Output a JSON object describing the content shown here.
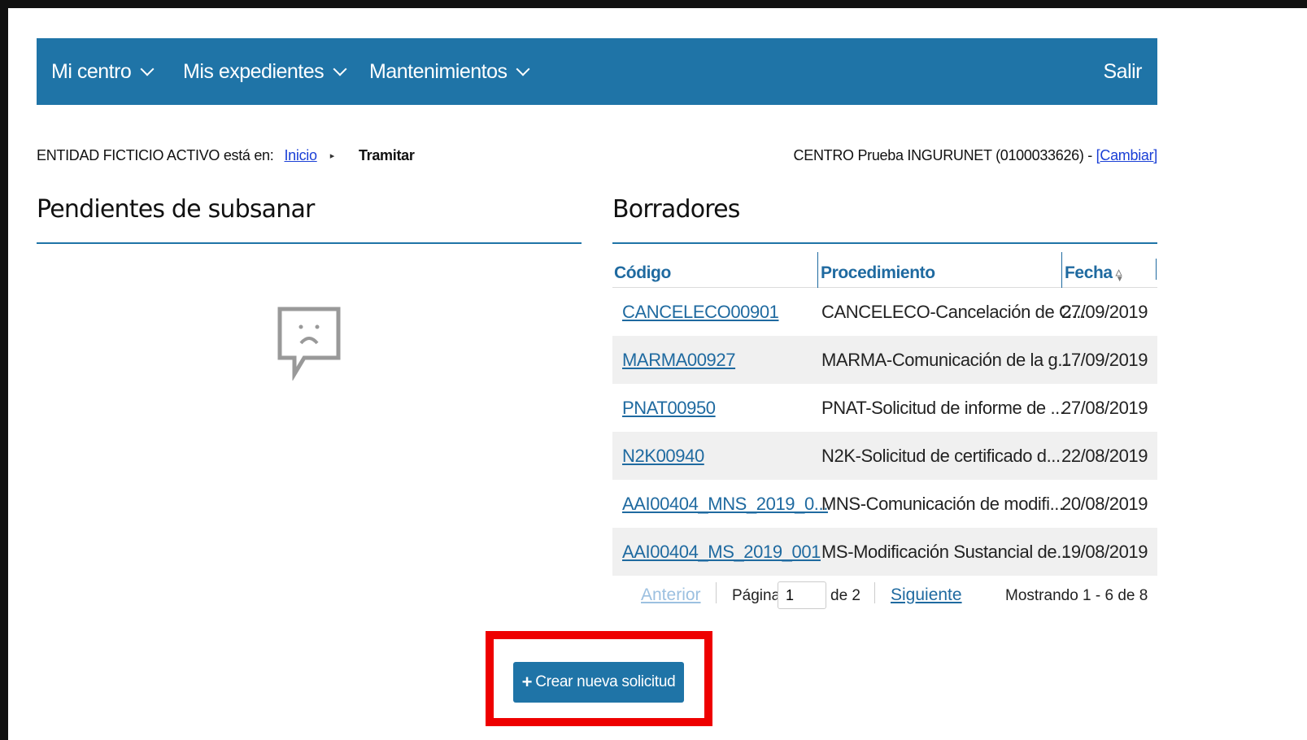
{
  "nav": {
    "mi_centro": "Mi centro",
    "mis_expedientes": "Mis expedientes",
    "mantenimientos": "Mantenimientos",
    "salir": "Salir"
  },
  "breadcrumb": {
    "prefix": "ENTIDAD FICTICIO ACTIVO está en:",
    "home": "Inicio",
    "current": "Tramitar"
  },
  "center": {
    "text": "CENTRO Prueba INGURUNET (0100033626) -",
    "change_link": "[Cambiar]"
  },
  "pendientes": {
    "title": "Pendientes de subsanar",
    "empty_icon": "sad-speech-bubble-icon"
  },
  "borradores": {
    "title": "Borradores",
    "columns": {
      "codigo": "Código",
      "procedimiento": "Procedimiento",
      "fecha": "Fecha"
    },
    "rows": [
      {
        "codigo": "CANCELECO00901",
        "procedimiento": "CANCELECO-Cancelación de C...",
        "fecha": "27/09/2019"
      },
      {
        "codigo": "MARMA00927",
        "procedimiento": "MARMA-Comunicación de la g...",
        "fecha": "17/09/2019"
      },
      {
        "codigo": "PNAT00950",
        "procedimiento": "PNAT-Solicitud de informe de ...",
        "fecha": "27/08/2019"
      },
      {
        "codigo": "N2K00940",
        "procedimiento": "N2K-Solicitud de certificado d...",
        "fecha": "22/08/2019"
      },
      {
        "codigo": "AAI00404_MNS_2019_0...",
        "procedimiento": "MNS-Comunicación de modifi...",
        "fecha": "20/08/2019"
      },
      {
        "codigo": "AAI00404_MS_2019_001",
        "procedimiento": "MS-Modificación Sustancial de...",
        "fecha": "19/08/2019"
      }
    ],
    "pager": {
      "prev": "Anterior",
      "page_label": "Página",
      "page_value": "1",
      "of_label": "de 2",
      "next": "Siguiente",
      "showing": "Mostrando 1 - 6 de 8"
    }
  },
  "actions": {
    "new_request": "Crear nueva solicitud"
  },
  "colors": {
    "nav_bg": "#1f74a7",
    "link": "#1f6aa0",
    "highlight": "#ee0000"
  }
}
